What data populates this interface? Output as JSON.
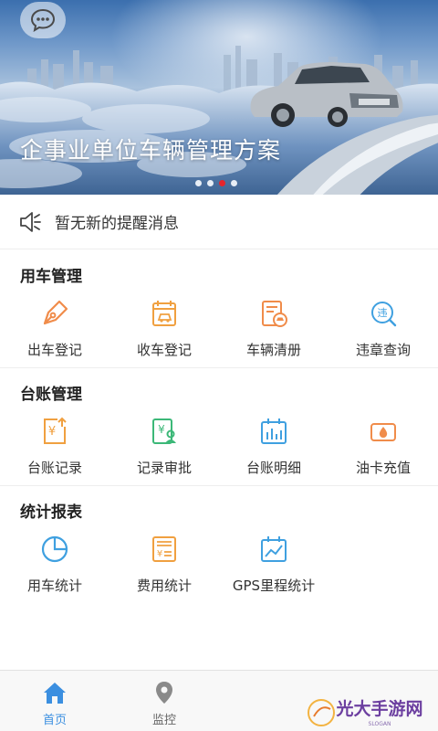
{
  "banner": {
    "title": "企事业单位车辆管理方案",
    "slide_count": 4,
    "active_slide": 3
  },
  "notice": {
    "text": "暂无新的提醒消息"
  },
  "sections": [
    {
      "title": "用车管理",
      "items": [
        {
          "label": "出车登记",
          "icon": "pen-nib-icon",
          "color": "#f08c4a"
        },
        {
          "label": "收车登记",
          "icon": "calendar-car-icon",
          "color": "#f0a040"
        },
        {
          "label": "车辆清册",
          "icon": "car-list-icon",
          "color": "#f08c4a"
        },
        {
          "label": "违章查询",
          "icon": "violation-search-icon",
          "color": "#3fa0e0"
        }
      ]
    },
    {
      "title": "台账管理",
      "items": [
        {
          "label": "台账记录",
          "icon": "yen-upload-icon",
          "color": "#f0a040"
        },
        {
          "label": "记录审批",
          "icon": "yen-approve-icon",
          "color": "#3cb878"
        },
        {
          "label": "台账明细",
          "icon": "bar-chart-icon",
          "color": "#3fa0e0"
        },
        {
          "label": "油卡充值",
          "icon": "fuel-card-icon",
          "color": "#f08c4a"
        }
      ]
    },
    {
      "title": "统计报表",
      "items": [
        {
          "label": "用车统计",
          "icon": "pie-chart-icon",
          "color": "#3fa0e0"
        },
        {
          "label": "费用统计",
          "icon": "expense-doc-icon",
          "color": "#f0a040"
        },
        {
          "label": "GPS里程统计",
          "icon": "line-chart-icon",
          "color": "#3fa0e0"
        }
      ]
    }
  ],
  "tabbar": {
    "items": [
      {
        "label": "首页",
        "icon": "home-icon",
        "active": true
      },
      {
        "label": "监控",
        "icon": "location-pin-icon",
        "active": false
      }
    ]
  },
  "colors": {
    "accent": "#3b8fe0",
    "banner_active_dot": "#e6242b"
  },
  "watermark": {
    "text": "光大手游网",
    "sub": "SLOGAN"
  }
}
